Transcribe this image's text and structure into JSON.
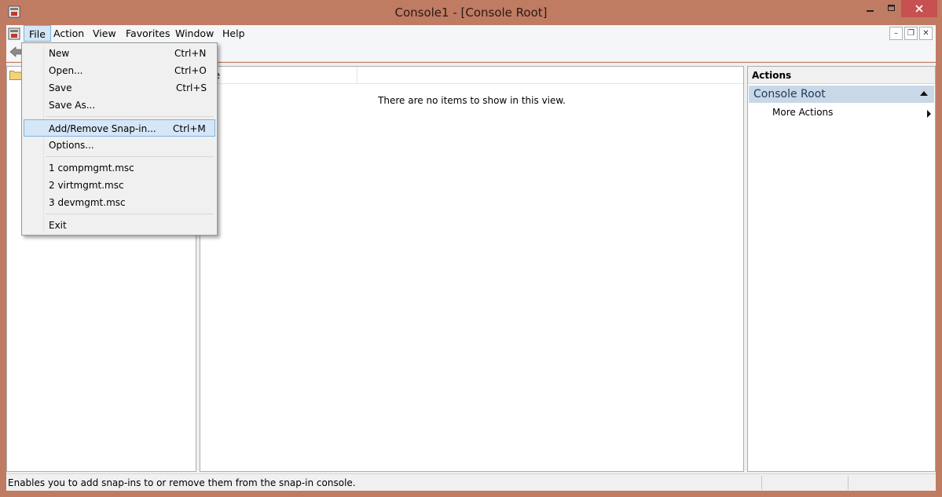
{
  "window": {
    "title": "Console1 - [Console Root]"
  },
  "menubar": {
    "items": [
      "File",
      "Action",
      "View",
      "Favorites",
      "Window",
      "Help"
    ]
  },
  "file_menu": {
    "items": [
      {
        "label": "New",
        "shortcut": "Ctrl+N"
      },
      {
        "label": "Open...",
        "shortcut": "Ctrl+O"
      },
      {
        "label": "Save",
        "shortcut": "Ctrl+S"
      },
      {
        "label": "Save As...",
        "shortcut": ""
      },
      {
        "label": "Add/Remove Snap-in...",
        "shortcut": "Ctrl+M"
      },
      {
        "label": "Options...",
        "shortcut": ""
      },
      {
        "label": "1 compmgmt.msc",
        "shortcut": ""
      },
      {
        "label": "2 virtmgmt.msc",
        "shortcut": ""
      },
      {
        "label": "3 devmgmt.msc",
        "shortcut": ""
      },
      {
        "label": "Exit",
        "shortcut": ""
      }
    ],
    "highlighted": "Add/Remove Snap-in..."
  },
  "list": {
    "column_header": "me",
    "empty_message": "There are no items to show in this view."
  },
  "actions": {
    "header": "Actions",
    "group": "Console Root",
    "more": "More Actions"
  },
  "status": {
    "text": "Enables you to add snap-ins to or remove them from the snap-in console."
  },
  "colors": {
    "frame": "#c07b63",
    "close_button": "#c75050",
    "highlight": "#d5e6f7",
    "actions_group_bg": "#c9d8e7"
  },
  "icons": [
    "app-icon",
    "minimize-icon",
    "maximize-icon",
    "close-icon",
    "back-icon",
    "folder-icon",
    "collapse-icon",
    "arrow-right-icon"
  ]
}
